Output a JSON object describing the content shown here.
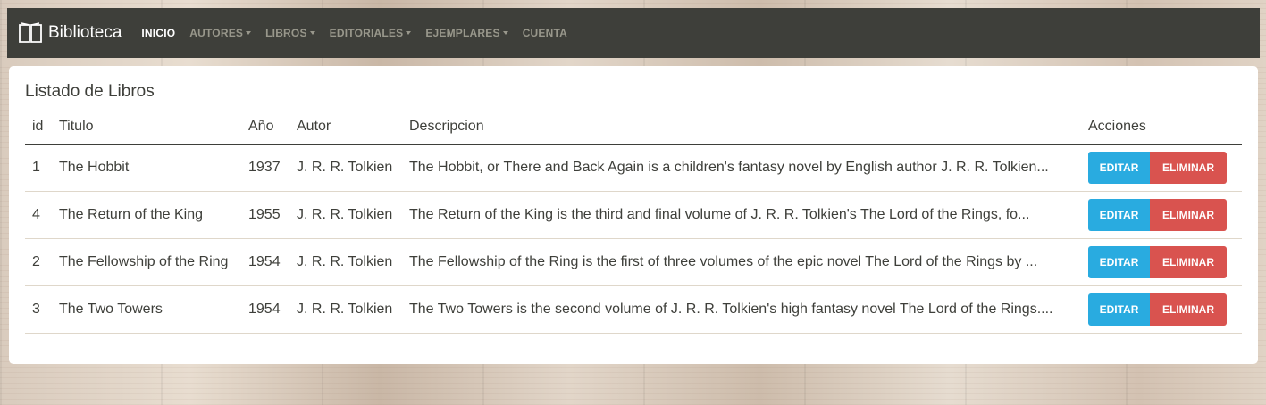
{
  "navbar": {
    "brand": "Biblioteca",
    "brand_icon": "book-icon",
    "items": [
      {
        "label": "INICIO",
        "dropdown": false,
        "active": true
      },
      {
        "label": "AUTORES",
        "dropdown": true,
        "active": false
      },
      {
        "label": "LIBROS",
        "dropdown": true,
        "active": false
      },
      {
        "label": "EDITORIALES",
        "dropdown": true,
        "active": false
      },
      {
        "label": "EJEMPLARES",
        "dropdown": true,
        "active": false
      },
      {
        "label": "CUENTA",
        "dropdown": false,
        "active": false
      }
    ],
    "colors": {
      "bg": "#3e3f3a",
      "text": "#98978b",
      "active": "#ffffff"
    }
  },
  "main": {
    "title": "Listado de Libros",
    "columns": [
      "id",
      "Titulo",
      "Año",
      "Autor",
      "Descripcion",
      "Acciones"
    ],
    "rows": [
      {
        "id": "1",
        "titulo": "The Hobbit",
        "anio": "1937",
        "autor": "J. R. R. Tolkien",
        "descripcion": "The Hobbit, or There and Back Again is a children's fantasy novel by English author J. R. R. Tolkien..."
      },
      {
        "id": "4",
        "titulo": "The Return of the King",
        "anio": "1955",
        "autor": "J. R. R. Tolkien",
        "descripcion": "The Return of the King is the third and final volume of J. R. R. Tolkien's The Lord of the Rings, fo..."
      },
      {
        "id": "2",
        "titulo": "The Fellowship of the Ring",
        "anio": "1954",
        "autor": "J. R. R. Tolkien",
        "descripcion": "The Fellowship of the Ring is the first of three volumes of the epic novel The Lord of the Rings by ..."
      },
      {
        "id": "3",
        "titulo": "The Two Towers",
        "anio": "1954",
        "autor": "J. R. R. Tolkien",
        "descripcion": "The Two Towers is the second volume of J. R. R. Tolkien's high fantasy novel The Lord of the Rings...."
      }
    ],
    "actions": {
      "edit_label": "EDITAR",
      "delete_label": "ELIMINAR"
    },
    "colors": {
      "edit": "#29abe0",
      "delete": "#d9534f"
    }
  }
}
